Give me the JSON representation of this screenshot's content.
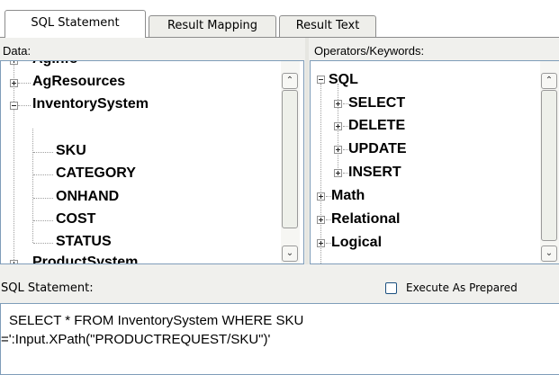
{
  "tabs": [
    {
      "label": "SQL Statement",
      "active": true
    },
    {
      "label": "Result Mapping",
      "active": false
    },
    {
      "label": "Result Text",
      "active": false
    }
  ],
  "data_panel": {
    "label": "Data:",
    "items": [
      {
        "label": "AgInfo",
        "expander": "plus"
      },
      {
        "label": "AgResources",
        "expander": "plus"
      },
      {
        "label": "InventorySystem",
        "expander": "minus"
      },
      {
        "label": "SKU"
      },
      {
        "label": "CATEGORY"
      },
      {
        "label": "ONHAND"
      },
      {
        "label": "COST"
      },
      {
        "label": "STATUS"
      },
      {
        "label": "ProductSystem",
        "expander": "plus"
      }
    ]
  },
  "operators_panel": {
    "label": "Operators/Keywords:",
    "items": [
      {
        "label": "SQL",
        "expander": "minus"
      },
      {
        "label": "SELECT",
        "expander": "plus"
      },
      {
        "label": "DELETE",
        "expander": "plus"
      },
      {
        "label": "UPDATE",
        "expander": "plus"
      },
      {
        "label": "INSERT",
        "expander": "plus"
      },
      {
        "label": "Math",
        "expander": "plus"
      },
      {
        "label": "Relational",
        "expander": "plus"
      },
      {
        "label": "Logical",
        "expander": "plus"
      }
    ]
  },
  "sql": {
    "label": "SQL Statement:",
    "execute_as_prepared_label": "Execute As Prepared",
    "execute_as_prepared_checked": false,
    "statement_line1": "SELECT * FROM InventorySystem WHERE SKU",
    "statement_line2": "=':Input.XPath(\"PRODUCTREQUEST/SKU\")'"
  },
  "icons": {
    "expand": "plus-box-icon",
    "collapse": "minus-box-icon",
    "scroll_up": "chevron-up-icon",
    "scroll_down": "chevron-down-icon"
  }
}
